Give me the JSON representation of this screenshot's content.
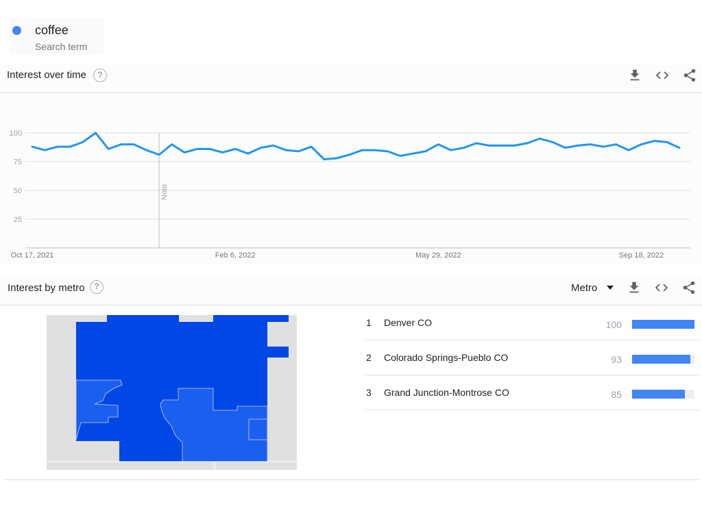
{
  "search_term": {
    "name": "coffee",
    "subtitle": "Search term",
    "color": "#4285f4"
  },
  "interest_over_time": {
    "title": "Interest over time",
    "help_icon": "help-question-icon",
    "actions": [
      "download-icon",
      "embed-code-icon",
      "share-icon"
    ]
  },
  "chart_data": {
    "type": "line",
    "title": "",
    "xlabel": "",
    "ylabel": "",
    "ylim": [
      0,
      100
    ],
    "y_ticks": [
      "100",
      "75",
      "50",
      "25"
    ],
    "x_ticks": [
      "Oct 17, 2021",
      "Feb 6, 2022",
      "May 29, 2022",
      "Sep 18, 2022"
    ],
    "x_tick_indices": [
      0,
      16,
      32,
      48
    ],
    "grid": true,
    "annotations": [
      {
        "label": "Note",
        "x_index": 10
      }
    ],
    "series": [
      {
        "color": "#2196f3",
        "values": [
          88,
          85,
          88,
          88,
          92,
          100,
          86,
          90,
          90,
          85,
          81,
          90,
          83,
          86,
          86,
          83,
          86,
          82,
          87,
          89,
          85,
          84,
          88,
          77,
          78,
          81,
          85,
          85,
          84,
          80,
          82,
          84,
          90,
          85,
          87,
          91,
          89,
          89,
          89,
          91,
          95,
          92,
          87,
          89,
          90,
          88,
          90,
          85,
          90,
          93,
          92,
          87
        ]
      }
    ]
  },
  "interest_by_metro": {
    "title": "Interest by metro",
    "help_icon": "help-question-icon",
    "dropdown_label": "Metro",
    "actions": [
      "download-icon",
      "embed-code-icon",
      "share-icon"
    ],
    "rows": [
      {
        "rank": "1",
        "name": "Denver CO",
        "value": 100
      },
      {
        "rank": "2",
        "name": "Colorado Springs-Pueblo CO",
        "value": 93
      },
      {
        "rank": "3",
        "name": "Grand Junction-Montrose CO",
        "value": 85
      }
    ],
    "bar_color": "#4285f4",
    "map_colors": {
      "high": "#0047e6",
      "mid": "#1a5ff0",
      "other": "#e0e0e0"
    }
  }
}
